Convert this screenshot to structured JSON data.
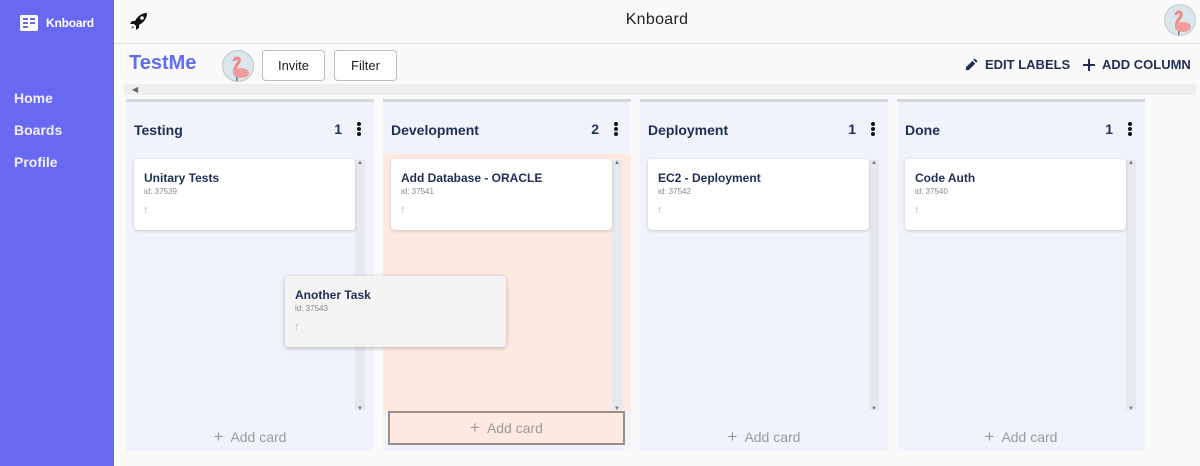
{
  "logo": {
    "text": "Knboard"
  },
  "nav": [
    {
      "label": "Home"
    },
    {
      "label": "Boards"
    },
    {
      "label": "Profile"
    }
  ],
  "topbar": {
    "title": "Knboard"
  },
  "board": {
    "title": "TestMe",
    "invite_label": "Invite",
    "filter_label": "Filter",
    "edit_labels": "EDIT LABELS",
    "add_column": "ADD COLUMN"
  },
  "columns": [
    {
      "title": "Testing",
      "count": "1",
      "add_label": "Add card",
      "cards": [
        {
          "title": "Unitary Tests",
          "id": "id: 37539"
        }
      ]
    },
    {
      "title": "Development",
      "count": "2",
      "add_label": "Add card",
      "cards": [
        {
          "title": "Add Database - ORACLE",
          "id": "id: 37541"
        }
      ]
    },
    {
      "title": "Deployment",
      "count": "1",
      "add_label": "Add card",
      "cards": [
        {
          "title": "EC2 - Deployment",
          "id": "id: 37542"
        }
      ]
    },
    {
      "title": "Done",
      "count": "1",
      "add_label": "Add card",
      "cards": [
        {
          "title": "Code Auth",
          "id": "id: 37540"
        }
      ]
    }
  ],
  "dragging_card": {
    "title": "Another Task",
    "id": "id: 37543"
  },
  "colors": {
    "sidebar": "#6868f0",
    "accent": "#5f6ef2",
    "column_bg": "#f0f3f9",
    "drop_target": "#fde9e2",
    "text_dark": "#1f2e57"
  },
  "icons": {
    "logo": "knboard-logo-icon",
    "rocket": "rocket-icon",
    "avatar": "flamingo-avatar",
    "edit": "pencil-icon",
    "add": "plus-icon",
    "menu": "more-vert-icon",
    "card_priority": "arrow-up-icon"
  }
}
